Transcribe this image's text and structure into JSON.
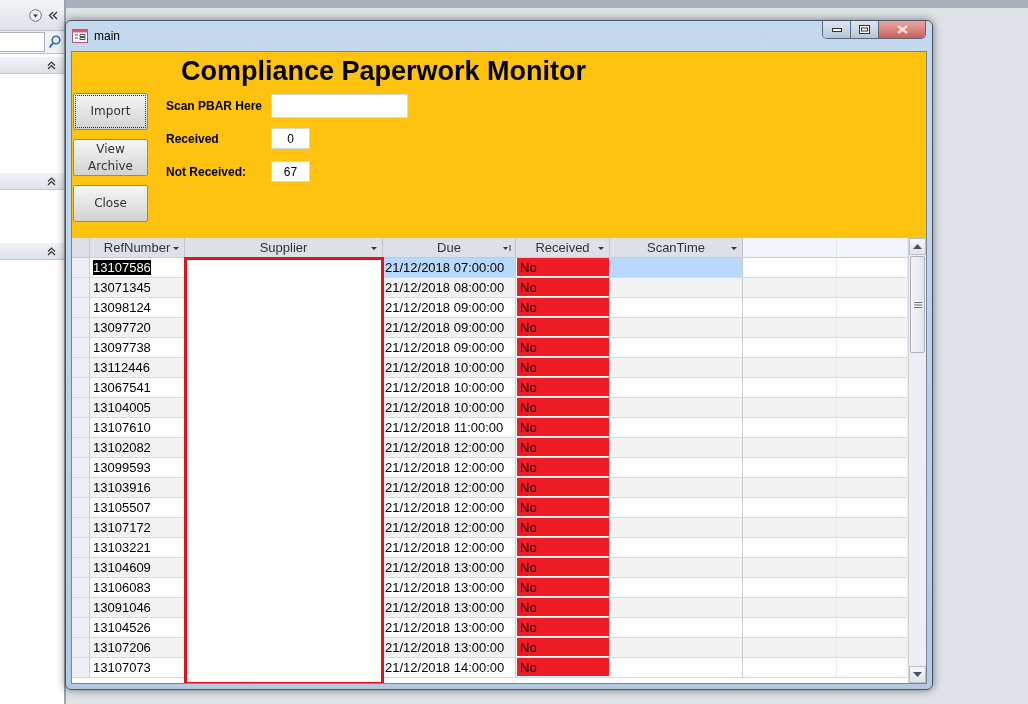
{
  "window": {
    "title": "main"
  },
  "form": {
    "title": "Compliance Paperwork Monitor",
    "buttons": [
      {
        "label": "Import",
        "focused": true
      },
      {
        "label": "View Archive",
        "focused": false
      },
      {
        "label": "Close",
        "focused": false
      }
    ],
    "fields": [
      {
        "label": "Scan PBAR Here",
        "kind": "scan"
      },
      {
        "label": "Received",
        "value": "0",
        "kind": "count"
      },
      {
        "label": "Not Received:",
        "value": "67",
        "kind": "count"
      }
    ]
  },
  "table": {
    "columns": [
      {
        "label": "RefNumber",
        "sorted": false
      },
      {
        "label": "Supplier",
        "sorted": false
      },
      {
        "label": "Due",
        "sorted": true
      },
      {
        "label": "Received",
        "sorted": false
      },
      {
        "label": "ScanTime",
        "sorted": false
      }
    ],
    "rows": [
      {
        "ref": "13107586",
        "due": "21/12/2018 07:00:00",
        "received_text": "No",
        "received": false,
        "selected": true
      },
      {
        "ref": "13071345",
        "due": "21/12/2018 08:00:00",
        "received_text": "No",
        "received": false,
        "selected": false
      },
      {
        "ref": "13098124",
        "due": "21/12/2018 09:00:00",
        "received_text": "No",
        "received": false,
        "selected": false
      },
      {
        "ref": "13097720",
        "due": "21/12/2018 09:00:00",
        "received_text": "No",
        "received": false,
        "selected": false
      },
      {
        "ref": "13097738",
        "due": "21/12/2018 09:00:00",
        "received_text": "No",
        "received": false,
        "selected": false
      },
      {
        "ref": "13112446",
        "due": "21/12/2018 10:00:00",
        "received_text": "No",
        "received": false,
        "selected": false
      },
      {
        "ref": "13067541",
        "due": "21/12/2018 10:00:00",
        "received_text": "No",
        "received": false,
        "selected": false
      },
      {
        "ref": "13104005",
        "due": "21/12/2018 10:00:00",
        "received_text": "No",
        "received": false,
        "selected": false
      },
      {
        "ref": "13107610",
        "due": "21/12/2018 11:00:00",
        "received_text": "No",
        "received": false,
        "selected": false
      },
      {
        "ref": "13102082",
        "due": "21/12/2018 12:00:00",
        "received_text": "No",
        "received": false,
        "selected": false
      },
      {
        "ref": "13099593",
        "due": "21/12/2018 12:00:00",
        "received_text": "No",
        "received": false,
        "selected": false
      },
      {
        "ref": "13103916",
        "due": "21/12/2018 12:00:00",
        "received_text": "No",
        "received": false,
        "selected": false
      },
      {
        "ref": "13105507",
        "due": "21/12/2018 12:00:00",
        "received_text": "No",
        "received": false,
        "selected": false
      },
      {
        "ref": "13107172",
        "due": "21/12/2018 12:00:00",
        "received_text": "No",
        "received": false,
        "selected": false
      },
      {
        "ref": "13103221",
        "due": "21/12/2018 12:00:00",
        "received_text": "No",
        "received": false,
        "selected": false
      },
      {
        "ref": "13104609",
        "due": "21/12/2018 13:00:00",
        "received_text": "No",
        "received": false,
        "selected": false
      },
      {
        "ref": "13106083",
        "due": "21/12/2018 13:00:00",
        "received_text": "No",
        "received": false,
        "selected": false
      },
      {
        "ref": "13091046",
        "due": "21/12/2018 13:00:00",
        "received_text": "No",
        "received": false,
        "selected": false
      },
      {
        "ref": "13104526",
        "due": "21/12/2018 13:00:00",
        "received_text": "No",
        "received": false,
        "selected": false
      },
      {
        "ref": "13107206",
        "due": "21/12/2018 13:00:00",
        "received_text": "No",
        "received": false,
        "selected": false
      },
      {
        "ref": "13107073",
        "due": "21/12/2018 14:00:00",
        "received_text": "No",
        "received": false,
        "selected": false
      }
    ]
  }
}
